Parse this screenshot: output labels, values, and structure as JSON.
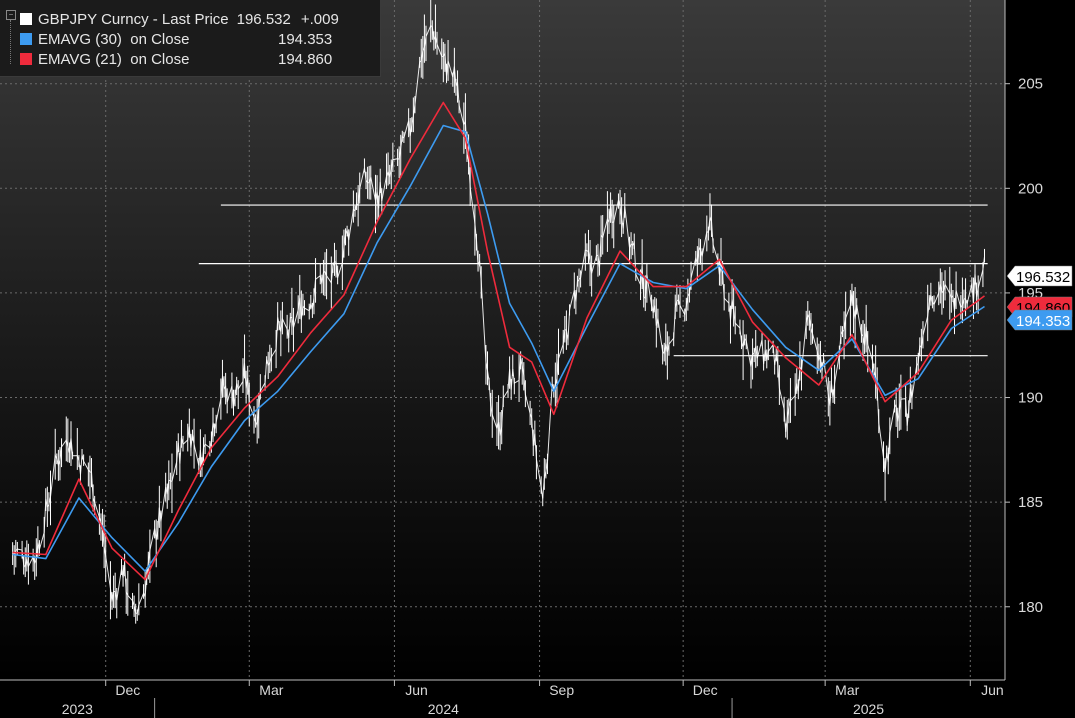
{
  "legend": {
    "rows": [
      {
        "label": "GBPJPY Curncy - Last Price",
        "value": "196.532",
        "change": "+.009",
        "color": "#ffffff"
      },
      {
        "label": "EMAVG (30)  on Close",
        "value": "194.353",
        "color": "#3d9bf0"
      },
      {
        "label": "EMAVG (21)  on Close",
        "value": "194.860",
        "color": "#ef2b3c"
      }
    ]
  },
  "chart_data": {
    "type": "line",
    "title": "",
    "xlabel": "",
    "ylabel": "",
    "ylim": [
      176.5,
      209
    ],
    "y_ticks": [
      180,
      185,
      190,
      195,
      200,
      205
    ],
    "x_month_ticks": [
      {
        "label": "Dec",
        "date": "2023-12"
      },
      {
        "label": "Mar",
        "date": "2024-03"
      },
      {
        "label": "Jun",
        "date": "2024-06"
      },
      {
        "label": "Sep",
        "date": "2024-09"
      },
      {
        "label": "Dec",
        "date": "2024-12"
      },
      {
        "label": "Mar",
        "date": "2025-03"
      },
      {
        "label": "Jun",
        "date": "2025-06"
      }
    ],
    "x_year_labels": [
      "2023",
      "2024",
      "2025"
    ],
    "price_labels": [
      {
        "value": "196.532",
        "bg": "#ffffff",
        "fg": "#000000"
      },
      {
        "value": "194.860",
        "bg": "#ef2b3c",
        "fg": "#000000"
      },
      {
        "value": "194.353",
        "bg": "#3d9bf0",
        "fg": "#ffffff"
      }
    ],
    "horizontal_lines": [
      {
        "y": 199.2,
        "from": "2024-02-12",
        "to": "2025-06-12"
      },
      {
        "y": 196.4,
        "from": "2024-01-29",
        "to": "2025-06-12"
      },
      {
        "y": 192.0,
        "from": "2024-11-25",
        "to": "2025-06-12"
      }
    ],
    "series": [
      {
        "name": "GBPJPY Curncy - Last Price",
        "color": "#ffffff",
        "x": [
          "2023-10-03",
          "2023-10-17",
          "2023-10-24",
          "2023-10-31",
          "2023-11-07",
          "2023-11-14",
          "2023-11-21",
          "2023-11-28",
          "2023-12-05",
          "2023-12-12",
          "2023-12-19",
          "2023-12-26",
          "2024-01-02",
          "2024-01-09",
          "2024-01-16",
          "2024-01-23",
          "2024-01-30",
          "2024-02-06",
          "2024-02-13",
          "2024-02-20",
          "2024-02-27",
          "2024-03-05",
          "2024-03-12",
          "2024-03-19",
          "2024-03-26",
          "2024-04-02",
          "2024-04-09",
          "2024-04-16",
          "2024-04-23",
          "2024-04-30",
          "2024-05-07",
          "2024-05-14",
          "2024-05-21",
          "2024-05-28",
          "2024-06-04",
          "2024-06-11",
          "2024-06-18",
          "2024-06-25",
          "2024-07-02",
          "2024-07-09",
          "2024-07-16",
          "2024-07-23",
          "2024-07-30",
          "2024-08-06",
          "2024-08-13",
          "2024-08-20",
          "2024-08-27",
          "2024-09-03",
          "2024-09-10",
          "2024-09-17",
          "2024-09-24",
          "2024-10-01",
          "2024-10-08",
          "2024-10-15",
          "2024-10-22",
          "2024-10-29",
          "2024-11-05",
          "2024-11-12",
          "2024-11-19",
          "2024-11-26",
          "2024-12-03",
          "2024-12-10",
          "2024-12-17",
          "2024-12-24",
          "2024-12-31",
          "2025-01-07",
          "2025-01-14",
          "2025-01-21",
          "2025-01-28",
          "2025-02-04",
          "2025-02-11",
          "2025-02-18",
          "2025-02-25",
          "2025-03-04",
          "2025-03-11",
          "2025-03-18",
          "2025-03-25",
          "2025-04-01",
          "2025-04-08",
          "2025-04-15",
          "2025-04-22",
          "2025-04-29",
          "2025-05-06",
          "2025-05-13",
          "2025-05-20",
          "2025-05-27",
          "2025-06-03",
          "2025-06-10"
        ],
        "y": [
          182.6,
          182.3,
          184.5,
          187.0,
          188.2,
          187.0,
          186.5,
          184.0,
          180.3,
          181.8,
          179.5,
          181.0,
          183.7,
          185.3,
          187.3,
          188.5,
          187.0,
          188.5,
          190.5,
          190.1,
          191.0,
          189.0,
          191.6,
          193.2,
          193.0,
          194.3,
          194.7,
          195.8,
          195.6,
          197.2,
          199.2,
          200.5,
          199.6,
          200.3,
          201.4,
          202.8,
          206.4,
          207.7,
          206.1,
          205.3,
          202.7,
          198.1,
          190.6,
          188.4,
          190.8,
          191.2,
          188.7,
          185.2,
          190.8,
          192.6,
          195.1,
          196.6,
          196.4,
          198.8,
          199.4,
          197.2,
          195.6,
          194.7,
          191.8,
          193.8,
          194.7,
          196.5,
          198.4,
          196.1,
          194.2,
          193.1,
          191.9,
          192.1,
          191.9,
          188.5,
          190.3,
          193.6,
          192.4,
          189.8,
          192.3,
          194.6,
          193.3,
          191.5,
          186.8,
          189.3,
          189.3,
          191.8,
          194.9,
          195.4,
          194.4,
          195.1,
          195.1,
          196.5
        ]
      },
      {
        "name": "EMAVG (30)  on Close",
        "color": "#3d9bf0",
        "x": [
          "2023-10-03",
          "2023-10-24",
          "2023-11-14",
          "2023-12-05",
          "2023-12-26",
          "2024-01-16",
          "2024-02-06",
          "2024-02-27",
          "2024-03-19",
          "2024-04-09",
          "2024-04-30",
          "2024-05-21",
          "2024-06-11",
          "2024-07-02",
          "2024-07-16",
          "2024-07-30",
          "2024-08-13",
          "2024-08-27",
          "2024-09-10",
          "2024-10-01",
          "2024-10-22",
          "2024-11-12",
          "2024-12-03",
          "2024-12-24",
          "2025-01-14",
          "2025-02-04",
          "2025-02-25",
          "2025-03-18",
          "2025-04-08",
          "2025-04-29",
          "2025-05-20",
          "2025-06-10"
        ],
        "y": [
          182.5,
          182.3,
          185.2,
          183.3,
          181.7,
          184.0,
          186.7,
          188.9,
          190.3,
          192.2,
          194.0,
          197.4,
          200.1,
          203.0,
          202.7,
          198.8,
          194.5,
          192.6,
          190.3,
          193.4,
          196.4,
          195.5,
          195.2,
          196.3,
          194.2,
          192.4,
          191.3,
          192.8,
          190.1,
          190.9,
          193.3,
          194.35
        ]
      },
      {
        "name": "EMAVG (21)  on Close",
        "color": "#ef2b3c",
        "x": [
          "2023-10-03",
          "2023-10-24",
          "2023-11-14",
          "2023-12-05",
          "2023-12-26",
          "2024-01-16",
          "2024-02-06",
          "2024-02-27",
          "2024-03-19",
          "2024-04-09",
          "2024-04-30",
          "2024-05-21",
          "2024-06-11",
          "2024-07-02",
          "2024-07-16",
          "2024-07-30",
          "2024-08-13",
          "2024-08-27",
          "2024-09-10",
          "2024-10-01",
          "2024-10-22",
          "2024-11-12",
          "2024-12-03",
          "2024-12-24",
          "2025-01-14",
          "2025-02-04",
          "2025-02-25",
          "2025-03-18",
          "2025-04-08",
          "2025-04-29",
          "2025-05-20",
          "2025-06-10"
        ],
        "y": [
          182.6,
          182.5,
          186.1,
          182.8,
          181.3,
          184.6,
          187.6,
          189.5,
          191.0,
          193.1,
          194.9,
          198.4,
          201.4,
          204.1,
          202.4,
          197.0,
          192.4,
          191.7,
          189.2,
          193.8,
          197.0,
          195.3,
          195.3,
          196.6,
          193.6,
          191.9,
          190.6,
          193.0,
          189.8,
          191.2,
          193.7,
          194.86
        ]
      }
    ]
  }
}
